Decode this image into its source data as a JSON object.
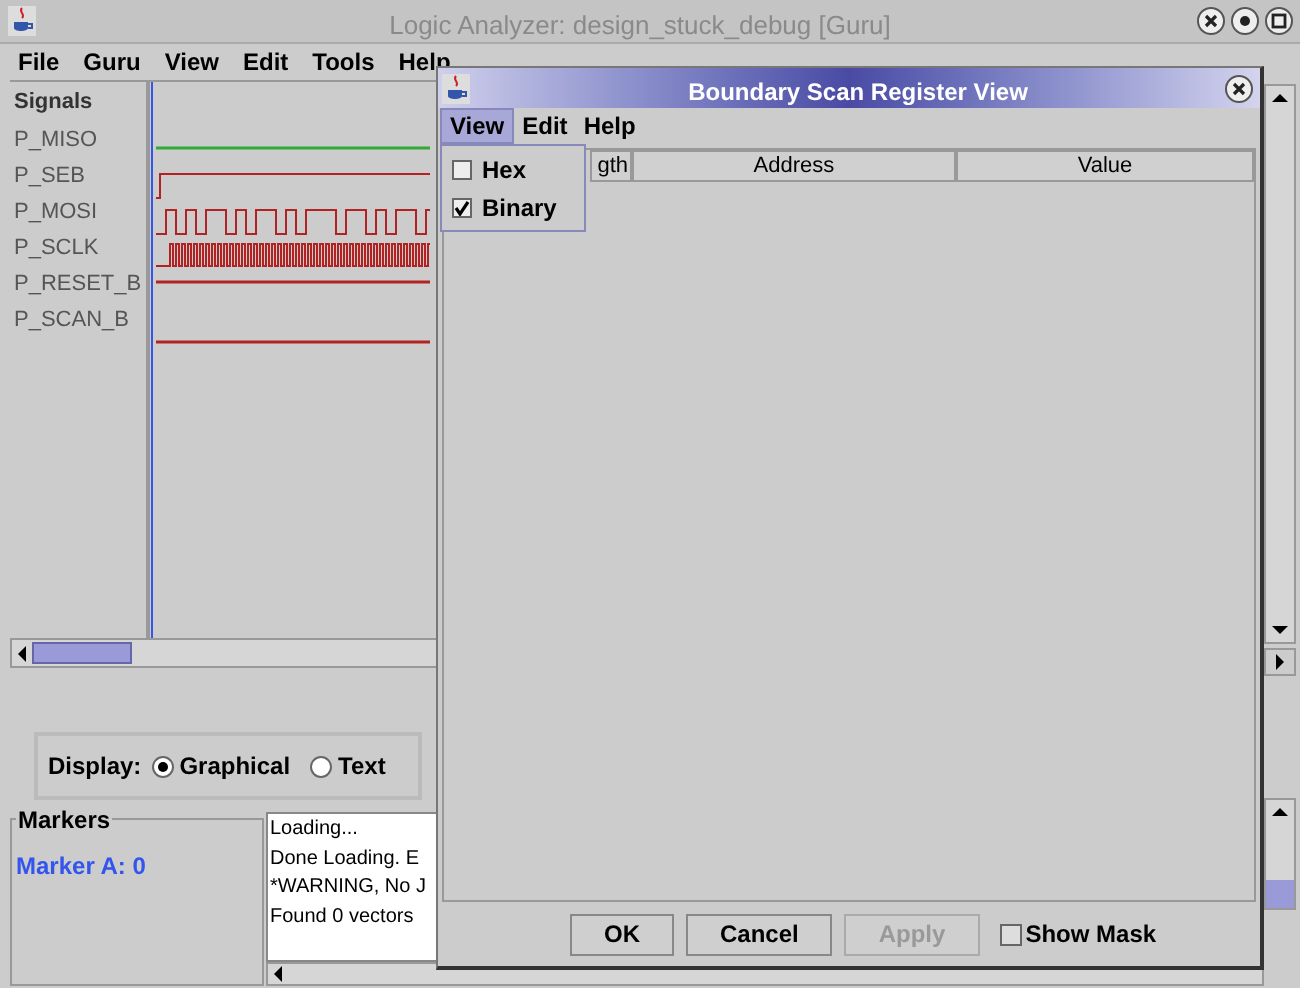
{
  "main_window": {
    "title": "Logic Analyzer: design_stuck_debug [Guru]",
    "menu": [
      "File",
      "Guru",
      "View",
      "Edit",
      "Tools",
      "Help"
    ]
  },
  "signals": {
    "header": "Signals",
    "items": [
      {
        "name": "P_MISO",
        "color": "#33aa33",
        "kind": "mid"
      },
      {
        "name": "P_SEB",
        "color": "#b22222",
        "kind": "step"
      },
      {
        "name": "P_MOSI",
        "color": "#b22222",
        "kind": "data"
      },
      {
        "name": "P_SCLK",
        "color": "#b22222",
        "kind": "clock"
      },
      {
        "name": "P_RESET_B",
        "color": "#b22222",
        "kind": "high"
      },
      {
        "name": "P_SCAN_B",
        "color": "#b22222",
        "kind": "low"
      }
    ]
  },
  "display": {
    "label": "Display:",
    "options": [
      {
        "label": "Graphical",
        "selected": true
      },
      {
        "label": "Text",
        "selected": false
      }
    ]
  },
  "markers": {
    "title": "Markers",
    "items": [
      "Marker A: 0"
    ]
  },
  "log": [
    "Loading...",
    "Done Loading. E",
    "*WARNING, No J",
    "Found 0 vectors"
  ],
  "dialog": {
    "title": "Boundary Scan Register View",
    "menu": [
      {
        "label": "View",
        "selected": true
      },
      {
        "label": "Edit",
        "selected": false
      },
      {
        "label": "Help",
        "selected": false
      }
    ],
    "view_menu": [
      {
        "label": "Hex",
        "checked": false
      },
      {
        "label": "Binary",
        "checked": true
      }
    ],
    "columns": [
      "gth",
      "Address",
      "Value"
    ],
    "buttons": [
      {
        "label": "OK",
        "disabled": false
      },
      {
        "label": "Cancel",
        "disabled": false
      },
      {
        "label": "Apply",
        "disabled": true
      }
    ],
    "show_mask": {
      "label": "Show Mask",
      "checked": false
    }
  }
}
